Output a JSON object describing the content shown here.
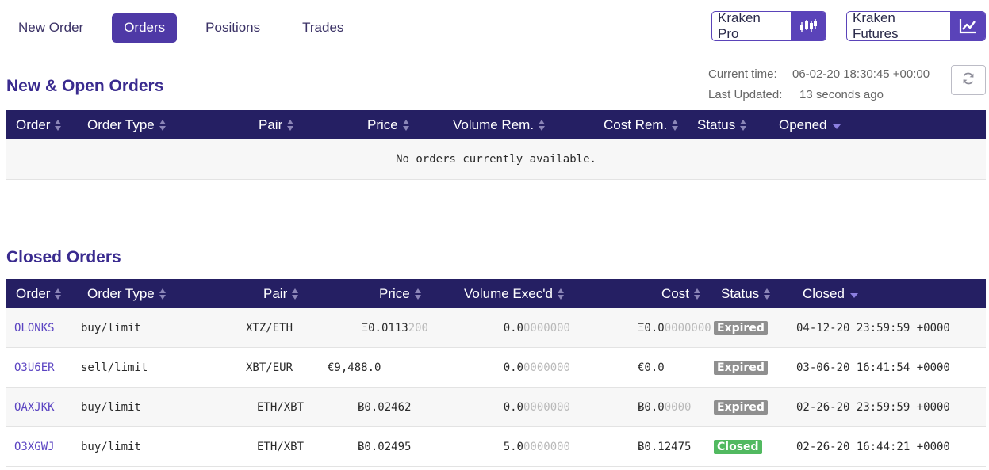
{
  "nav": {
    "tabs": [
      {
        "label": "New Order",
        "active": false
      },
      {
        "label": "Orders",
        "active": true
      },
      {
        "label": "Positions",
        "active": false
      },
      {
        "label": "Trades",
        "active": false
      }
    ],
    "external": [
      {
        "label": "Kraken Pro",
        "icon": "candlestick-icon"
      },
      {
        "label": "Kraken Futures",
        "icon": "line-chart-icon"
      }
    ]
  },
  "colors": {
    "accent": "#4e39a6",
    "header_bg": "#251f63",
    "title": "#3a2b8f",
    "expired": "#8f8f8f",
    "closed": "#51b960"
  },
  "open_orders": {
    "title": "New & Open Orders",
    "time_info": {
      "current_label": "Current time:",
      "current_value": "06-02-20 18:30:45 +00:00",
      "updated_label": "Last Updated:",
      "updated_value": "13 seconds ago"
    },
    "refresh_icon": "refresh-icon",
    "columns": [
      "Order",
      "Order Type",
      "Pair",
      "Price",
      "Volume Rem.",
      "Cost Rem.",
      "Status",
      "Opened"
    ],
    "sorted_column": "Opened",
    "empty_message": "No orders currently available."
  },
  "closed_orders": {
    "title": "Closed Orders",
    "columns": [
      "Order",
      "Order Type",
      "Pair",
      "Price",
      "Volume Exec'd",
      "Cost",
      "Status",
      "Closed"
    ],
    "sorted_column": "Closed",
    "rows": [
      {
        "order": "OLONKS",
        "type": "buy/limit",
        "pair": "XTZ/ETH",
        "price": "Ξ0.0113200",
        "volume": "0.00000000",
        "cost": "Ξ0.00000000",
        "status": "Expired",
        "closed": "04-12-20 23:59:59 +0000"
      },
      {
        "order": "O3U6ER",
        "type": "sell/limit",
        "pair": "XBT/EUR",
        "price": "€9,488.0",
        "volume": "0.00000000",
        "cost": "€0.0",
        "status": "Expired",
        "closed": "03-06-20 16:41:54 +0000"
      },
      {
        "order": "OAXJKK",
        "type": "buy/limit",
        "pair": "ETH/XBT",
        "price": "Ƀ0.02462",
        "volume": "0.00000000",
        "cost": "Ƀ0.00000",
        "status": "Expired",
        "closed": "02-26-20 23:59:59 +0000"
      },
      {
        "order": "O3XGWJ",
        "type": "buy/limit",
        "pair": "ETH/XBT",
        "price": "Ƀ0.02495",
        "volume": "5.00000000",
        "cost": "Ƀ0.12475",
        "status": "Closed",
        "closed": "02-26-20 16:44:21 +0000"
      }
    ]
  }
}
